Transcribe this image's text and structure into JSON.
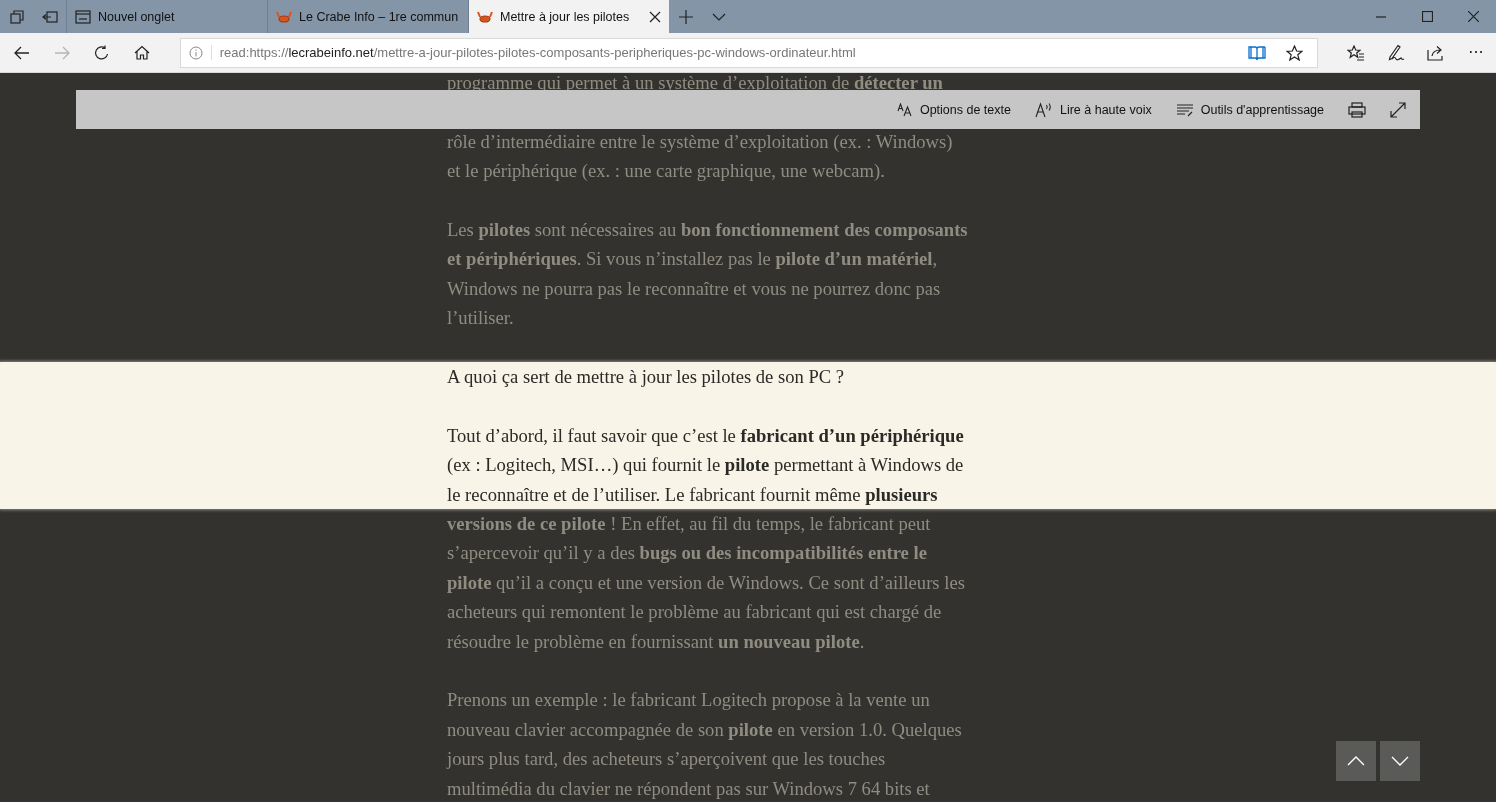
{
  "tabs": [
    {
      "label": "Nouvel onglet",
      "selected": false
    },
    {
      "label": "Le Crabe Info – 1re commun",
      "selected": false
    },
    {
      "label": "Mettre à jour les pilotes",
      "selected": true
    }
  ],
  "navigation": {
    "back_disabled": false,
    "forward_disabled": true
  },
  "address_bar": {
    "url_prefix": "read:https://",
    "url_domain": "lecrabeinfo.net",
    "url_path": "/mettre-a-jour-pilotes-pilotes-composants-peripheriques-pc-windows-ordinateur.html",
    "reading_view_on": true
  },
  "more_button": "···",
  "reader_toolbar": {
    "items": [
      {
        "label": "Options de texte"
      },
      {
        "label": "Lire à haute voix"
      },
      {
        "label": "Outils d'apprentissage"
      }
    ]
  },
  "article": {
    "above": [
      {
        "kind": "clipped",
        "lines": [
          "programme qui permet à un système d’exploitation de **détecter un**"
        ]
      },
      {
        "kind": "resumed",
        "lines": [
          "rôle d’intermédiaire entre le système d’exploitation (ex. : Windows)",
          "et le périphérique (ex. : une carte graphique, une webcam)."
        ]
      },
      {
        "kind": "paragraph",
        "lines": [
          "Les **pilotes** sont nécessaires au **bon fonctionnement des composants**",
          "**et périphériques**. Si vous n’installez pas le **pilote d’un matériel**,",
          "Windows ne pourra pas le reconnaître et vous ne pourrez donc pas",
          "l’utiliser."
        ]
      }
    ],
    "focus": [
      {
        "kind": "continued",
        "lines": [
          "A quoi ça sert de mettre à jour les pilotes de son PC ?"
        ]
      },
      {
        "kind": "paragraph",
        "lines": [
          "Tout d’abord, il faut savoir que c’est le **fabricant d’un périphérique**",
          "(ex : Logitech, MSI…) qui fournit le **pilote** permettant à Windows de",
          "le reconnaître et de l’utiliser. Le fabricant fournit même **plusieurs**"
        ]
      }
    ],
    "below": [
      {
        "kind": "continued",
        "lines": [
          "**versions de ce pilote** ! En effet, au fil du temps, le fabricant peut",
          "s’apercevoir qu’il y a des **bugs ou des incompatibilités entre le**",
          "**pilote** qu’il a conçu et une version de Windows. Ce sont d’ailleurs les",
          "acheteurs qui remontent le problème au fabricant qui est chargé de",
          "résoudre le problème en fournissant **un nouveau pilote**."
        ]
      },
      {
        "kind": "paragraph",
        "lines": [
          "Prenons un exemple : le fabricant Logitech propose à la vente un",
          "nouveau clavier accompagnée de son **pilote** en version 1.0. Quelques",
          "jours plus tard, des acheteurs s’aperçoivent que les touches",
          "multimédia du clavier ne répondent pas sur Windows 7 64 bits et"
        ]
      }
    ]
  }
}
